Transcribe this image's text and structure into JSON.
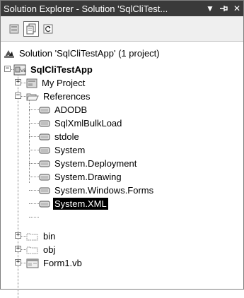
{
  "window": {
    "title": "Solution Explorer - Solution 'SqlCliTest...",
    "dropdown_glyph": "▼",
    "pin_glyph": "⊣",
    "close_glyph": "✕"
  },
  "toolbar": {
    "buttons": [
      {
        "icon": "properties-icon"
      },
      {
        "icon": "show-all-files-icon",
        "active": true
      },
      {
        "icon": "refresh-icon"
      }
    ]
  },
  "tree": {
    "solution": "Solution 'SqlCliTestApp' (1 project)",
    "project": "SqlCliTestApp",
    "my_project": "My Project",
    "references": "References",
    "refs": [
      "ADODB",
      "SqlXmlBulkLoad",
      "stdole",
      "System",
      "System.Deployment",
      "System.Drawing",
      "System.Windows.Forms",
      "System.XML"
    ],
    "selected_ref": "System.XML",
    "bin": "bin",
    "obj": "obj",
    "form": "Form1.vb"
  },
  "colors": {
    "titlebar": "#3a3a3a",
    "selection": "#000000"
  }
}
